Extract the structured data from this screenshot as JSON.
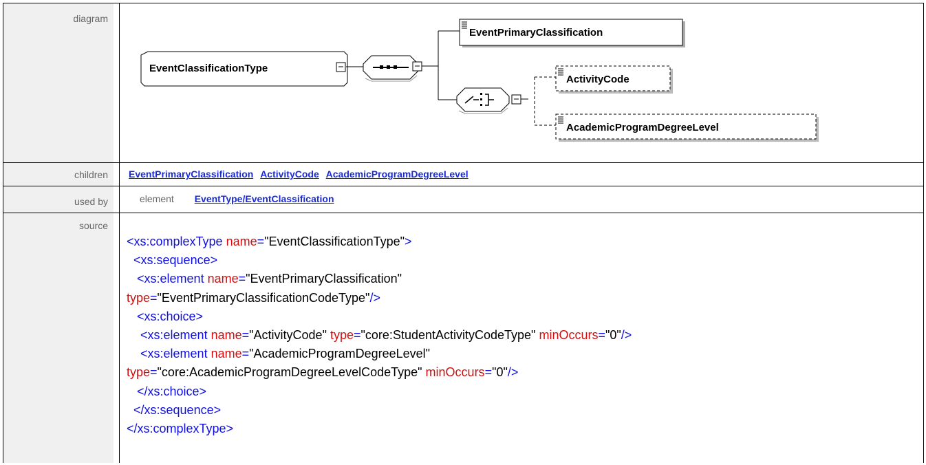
{
  "rows": {
    "diagram_label": "diagram",
    "children_label": "children",
    "usedby_label": "used by",
    "source_label": "source"
  },
  "diagram": {
    "root": "EventClassificationType",
    "nodes": {
      "primary": "EventPrimaryClassification",
      "activity": "ActivityCode",
      "degree": "AcademicProgramDegreeLevel"
    }
  },
  "children": [
    "EventPrimaryClassification",
    "ActivityCode",
    "AcademicProgramDegreeLevel"
  ],
  "used_by": {
    "kind": "element",
    "link": "EventType/EventClassification"
  },
  "source": {
    "l1_tag": "<xs:complexType",
    "l1_attr": "name",
    "l1_val": "\"EventClassificationType\"",
    "l1_end": ">",
    "l2": "<xs:sequence>",
    "l3_tag": "<xs:element",
    "l3_attr": "name",
    "l3_val": "\"EventPrimaryClassification\"",
    "l4_attr": "type",
    "l4_val": "\"EventPrimaryClassificationCodeType\"",
    "l4_end": "/>",
    "l5": "<xs:choice>",
    "l6_tag": "<xs:element",
    "l6_attr1": "name",
    "l6_val1": "\"ActivityCode\"",
    "l6_attr2": "type",
    "l6_val2": "\"core:StudentActivityCodeType\"",
    "l6_attr3": "minOccurs",
    "l6_val3": "\"0\"",
    "l6_end": "/>",
    "l7_tag": "<xs:element",
    "l7_attr": "name",
    "l7_val": "\"AcademicProgramDegreeLevel\"",
    "l8_attr1": "type",
    "l8_val1": "\"core:AcademicProgramDegreeLevelCodeType\"",
    "l8_attr2": "minOccurs",
    "l8_val2": "\"0\"",
    "l8_end": "/>",
    "l9": "</xs:choice>",
    "l10": "</xs:sequence>",
    "l11": "</xs:complexType>"
  }
}
